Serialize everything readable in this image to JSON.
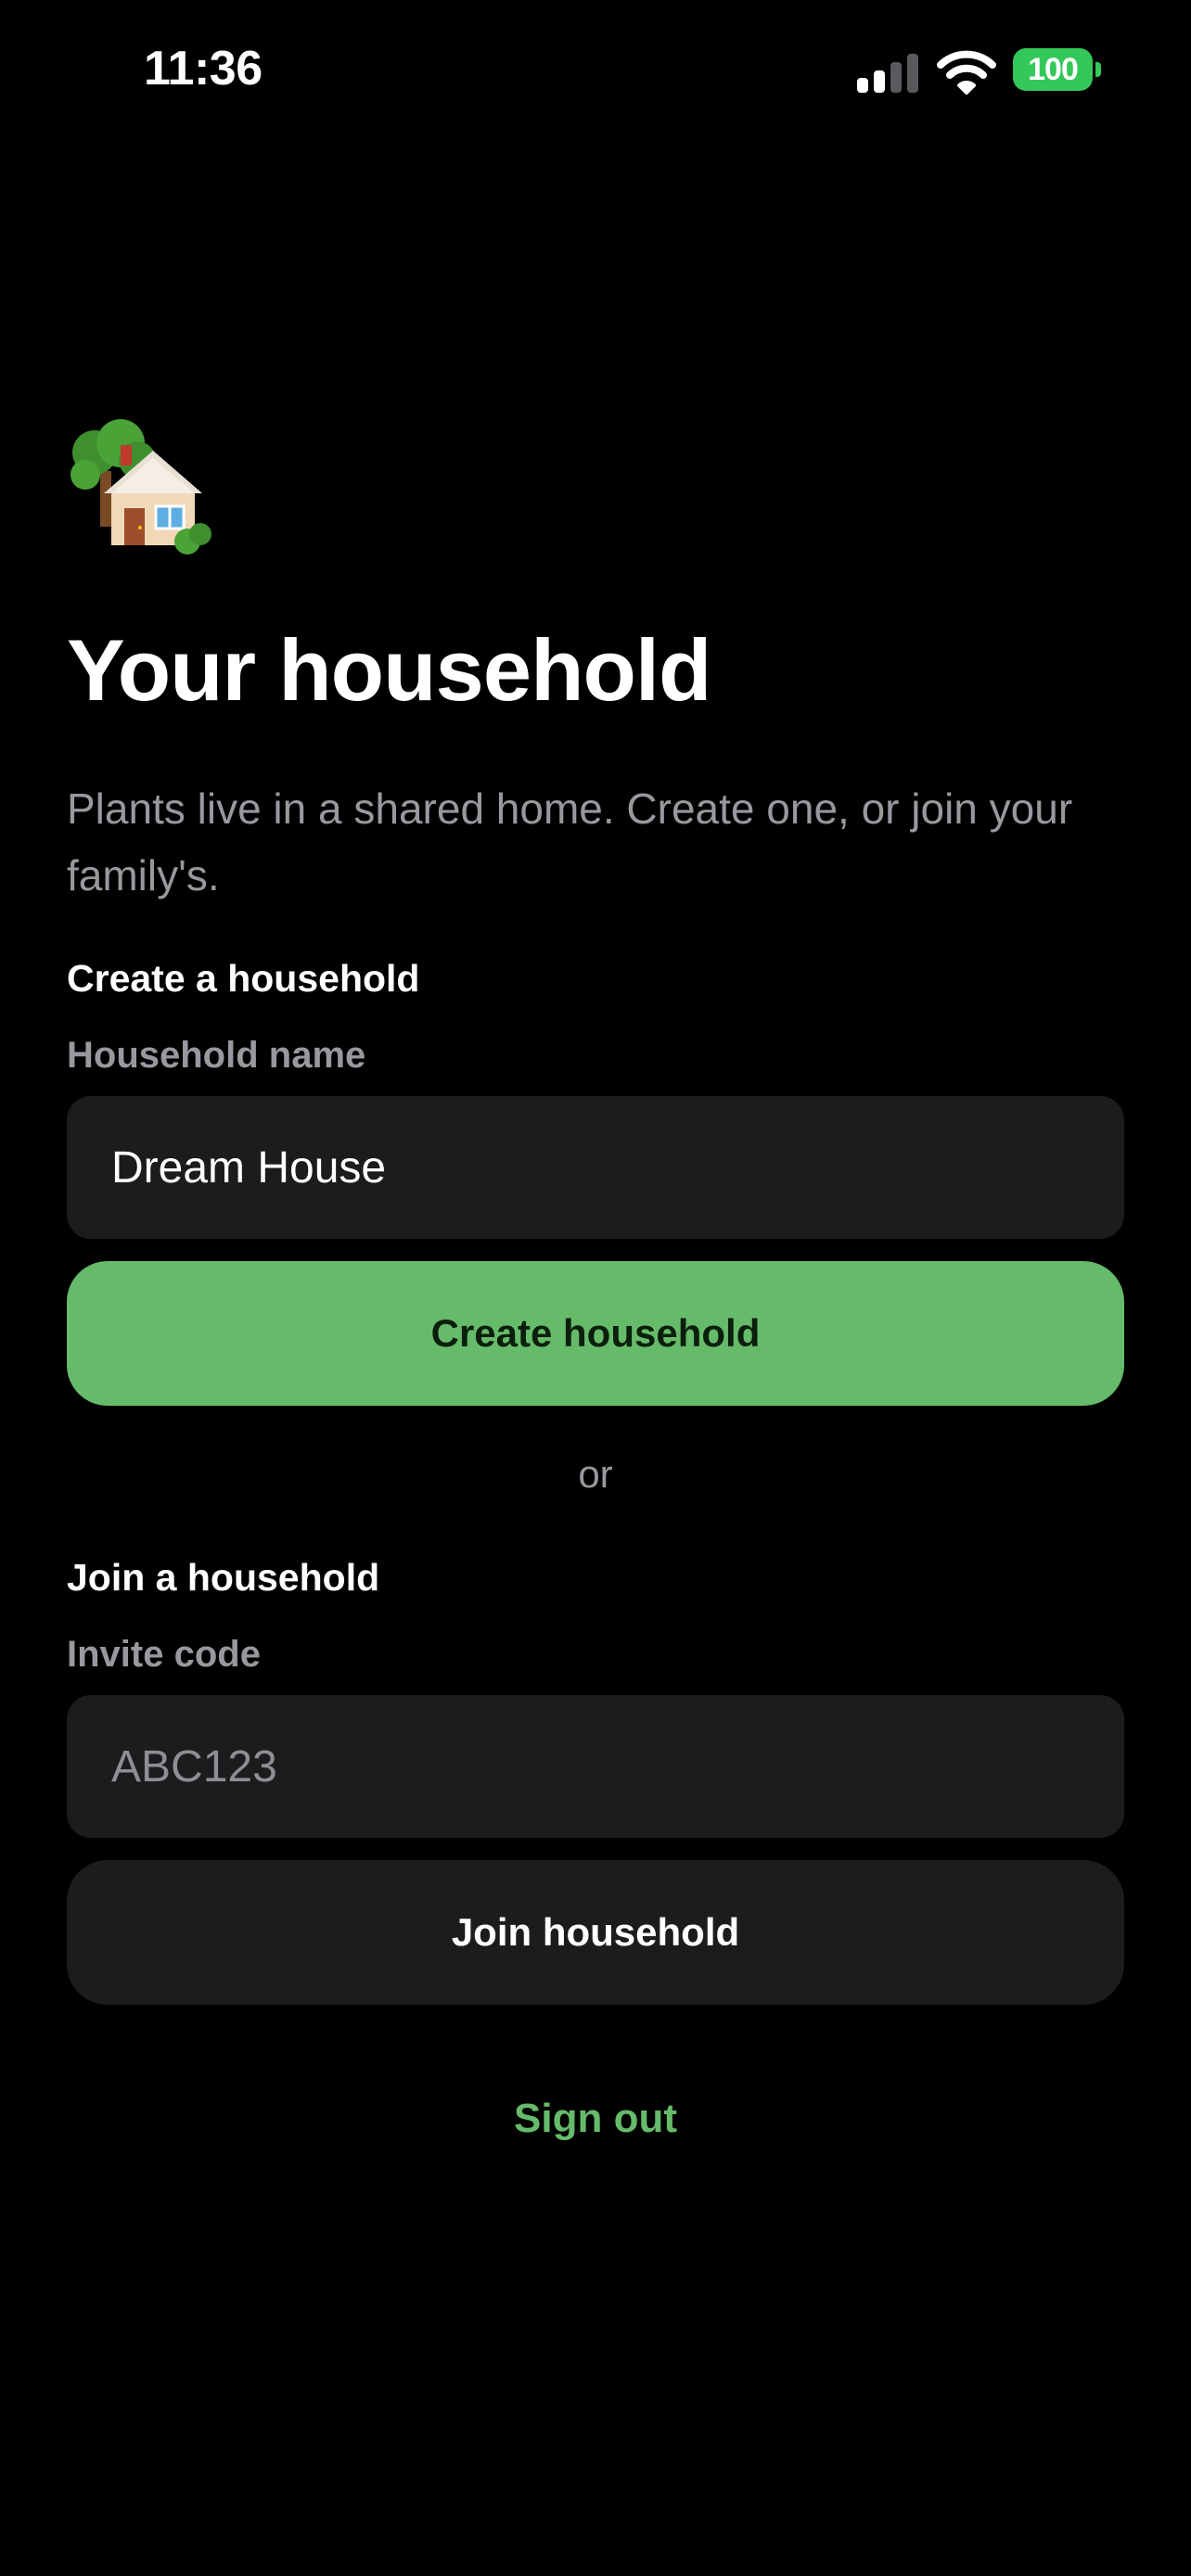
{
  "status_bar": {
    "time": "11:36",
    "battery": "100",
    "icons": [
      "cellular-signal-icon",
      "wifi-icon",
      "battery-icon"
    ]
  },
  "hero": {
    "emoji": "🏡",
    "icon_name": "house-with-garden-icon",
    "title": "Your household",
    "subtitle": "Plants live in a shared home. Create one, or join your family's."
  },
  "create": {
    "section_label": "Create a household",
    "field_label": "Household name",
    "value": "Dream House",
    "button_label": "Create household"
  },
  "divider": {
    "label": "or"
  },
  "join": {
    "section_label": "Join a household",
    "field_label": "Invite code",
    "placeholder": "ABC123",
    "value": "",
    "button_label": "Join household"
  },
  "footer": {
    "sign_out_label": "Sign out"
  },
  "colors": {
    "background": "#000000",
    "accent": "#66BB6A",
    "surface": "#1C1C1E",
    "secondary_text": "#98989F",
    "battery": "#34C759"
  }
}
